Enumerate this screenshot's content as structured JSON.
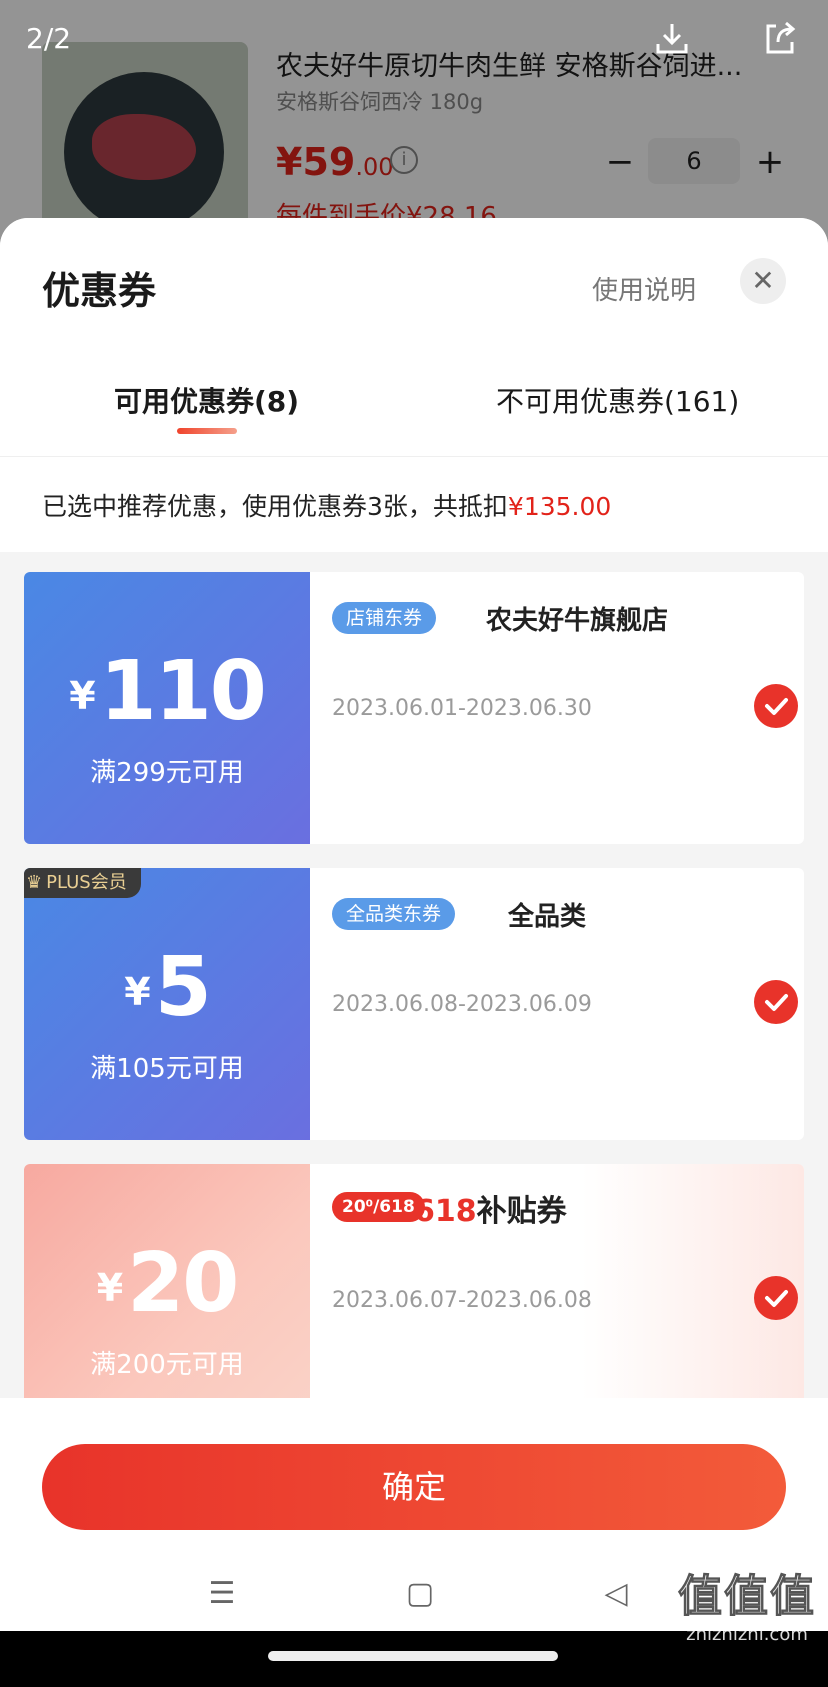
{
  "page_indicator": "2/2",
  "product": {
    "title": "农夫好牛原切牛肉生鲜 安格斯谷饲进...",
    "spec": "安格斯谷饲西冷 180g",
    "price_int": "¥59",
    "price_dec": ".00",
    "quantity": "6",
    "per_item_price": "每件到手价¥28.16",
    "minus": "−",
    "plus": "+"
  },
  "sheet": {
    "title": "优惠券",
    "usage_link": "使用说明",
    "close": "✕",
    "tabs": [
      {
        "label": "可用优惠券(8)",
        "active": true
      },
      {
        "label": "不可用优惠券(161)",
        "active": false
      }
    ],
    "summary_prefix": "已选中推荐优惠，使用优惠券3张，共抵扣",
    "summary_amount": "¥135.00"
  },
  "coupons": [
    {
      "yen": "¥",
      "amount": "110",
      "condition": "满299元可用",
      "tag": "店铺东券",
      "store": "农夫好牛旗舰店",
      "date": "2023.06.01-2023.06.30",
      "checked": true
    },
    {
      "badge": "PLUS会员",
      "yen": "¥",
      "amount": "5",
      "condition": "满105元可用",
      "tag": "全品类东券",
      "store": "全品类",
      "date": "2023.06.08-2023.06.09",
      "checked": true
    },
    {
      "yen": "¥",
      "amount": "20",
      "condition": "满200元可用",
      "tag": "20⁰/618",
      "title_red": "618",
      "title_rest": "补贴券",
      "date": "2023.06.07-2023.06.08",
      "checked": true
    }
  ],
  "confirm_label": "确定",
  "nav": {
    "menu": "☰",
    "home": "▢",
    "back": "◁"
  },
  "watermark": {
    "big": "值值值",
    "small": "zhizhizhi.com"
  },
  "colors": {
    "accent": "#e8332a",
    "blue_coupon": "#4a88e4",
    "pink_coupon": "#f7a9a0"
  }
}
